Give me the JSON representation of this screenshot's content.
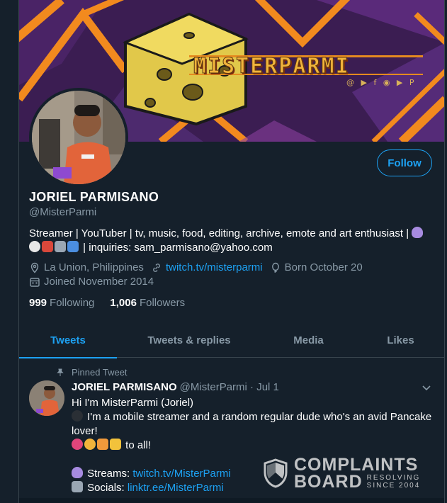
{
  "banner": {
    "title": "MISTERPARMI",
    "social_icons": "@ ▶ f ◉ ▶ P"
  },
  "profile": {
    "name": "JORIEL PARMISANO",
    "handle": "@MisterParmi",
    "bio_line1": "Streamer | YouTuber | tv, music, food, editing, archive, emote and art enthusiast |",
    "bio_line2": "| inquiries: sam_parmisano@yahoo.com",
    "location": "La Union, Philippines",
    "website": "twitch.tv/misterparmi",
    "birthday": "Born October 20",
    "joined": "Joined November 2014",
    "following_count": "999",
    "following_label": "Following",
    "followers_count": "1,006",
    "followers_label": "Followers",
    "follow_button": "Follow"
  },
  "tabs": [
    {
      "label": "Tweets",
      "active": true
    },
    {
      "label": "Tweets & replies",
      "active": false
    },
    {
      "label": "Media",
      "active": false
    },
    {
      "label": "Likes",
      "active": false
    }
  ],
  "tweet": {
    "pinned_label": "Pinned Tweet",
    "name": "JORIEL PARMISANO",
    "meta": "@MisterParmi · Jul 1",
    "line1": "Hi I'm MisterParmi (Joriel)",
    "line2": "I'm a mobile streamer and a random regular dude who's an avid Pancake lover!",
    "line3": "to all!",
    "streams_label": "Streams:",
    "streams_link": "twitch.tv/MisterParmi",
    "socials_label": "Socials:",
    "socials_link": "linktr.ee/MisterParmi"
  },
  "watermark": {
    "line1": "COMPLAINTS",
    "line2": "BOARD",
    "small1": "RESOLVING",
    "small2": "SINCE 2004"
  },
  "colors": {
    "background": "#15202b",
    "accent": "#1da1f2",
    "muted": "#8899a6",
    "border": "#38444d"
  }
}
